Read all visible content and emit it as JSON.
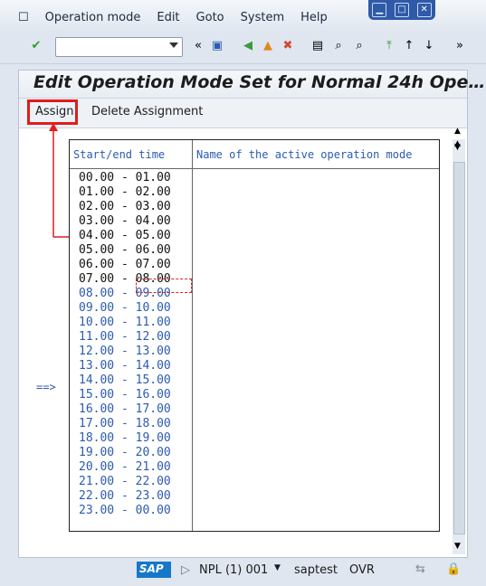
{
  "menu": {
    "items": [
      "Operation mode",
      "Edit",
      "Goto",
      "System",
      "Help"
    ]
  },
  "page": {
    "title": "Edit Operation Mode Set for Normal 24h Ope…"
  },
  "appToolbar": {
    "assign": "Assign",
    "deleteAssignment": "Delete Assignment"
  },
  "table": {
    "col1": "Start/end time",
    "col2": "Name of the active operation mode",
    "rows": [
      "00.00 - 01.00",
      "01.00 - 02.00",
      "02.00 - 03.00",
      "03.00 - 04.00",
      "04.00 - 05.00",
      "05.00 - 06.00",
      "06.00 - 07.00",
      "07.00 - 08.00",
      "08.00 - 09.00",
      "09.00 - 10.00",
      "10.00 - 11.00",
      "11.00 - 12.00",
      "12.00 - 13.00",
      "13.00 - 14.00",
      "14.00 - 15.00",
      "15.00 - 16.00",
      "16.00 - 17.00",
      "17.00 - 18.00",
      "18.00 - 19.00",
      "19.00 - 20.00",
      "20.00 - 21.00",
      "21.00 - 22.00",
      "22.00 - 23.00",
      "23.00 - 00.00"
    ],
    "marker": "==>"
  },
  "status": {
    "system": "NPL (1) 001",
    "user": "saptest",
    "mode": "OVR",
    "logo": "SAP"
  }
}
